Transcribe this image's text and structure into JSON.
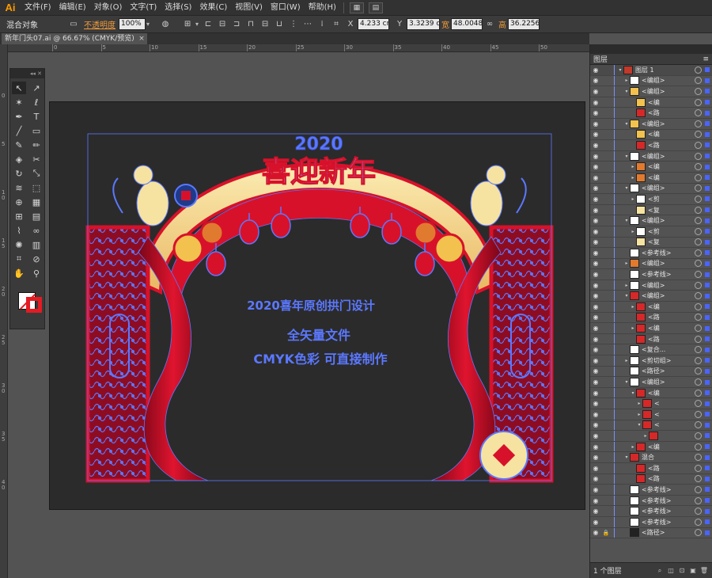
{
  "app": {
    "logo": "Ai"
  },
  "menu": {
    "items": [
      "文件(F)",
      "编辑(E)",
      "对象(O)",
      "文字(T)",
      "选择(S)",
      "效果(C)",
      "视图(V)",
      "窗口(W)",
      "帮助(H)"
    ]
  },
  "control": {
    "selection_type": "混合对象",
    "opacity_label": "不透明度",
    "opacity_value": "100%",
    "x_value": "4.233 cm",
    "y_value": "3.3239 cm",
    "w_label": "宽",
    "w_value": "48.0048",
    "h_label": "高",
    "h_value": "36.2256"
  },
  "document": {
    "tab_title": "新年门头07.ai @ 66.67% (CMYK/预览)",
    "close": "×"
  },
  "rulers": {
    "top": [
      "0",
      "5",
      "10",
      "15",
      "20",
      "25",
      "30",
      "35",
      "40",
      "45",
      "50"
    ],
    "left": [
      "0",
      "5",
      "1 0",
      "1 5",
      "2 0",
      "2 5",
      "3 0",
      "3 5",
      "4 0"
    ]
  },
  "tools": {
    "collapse": "◂◂ ✕",
    "items": [
      {
        "name": "selection-tool",
        "glyph": "↖"
      },
      {
        "name": "direct-selection-tool",
        "glyph": "↗"
      },
      {
        "name": "magic-wand-tool",
        "glyph": "✶"
      },
      {
        "name": "lasso-tool",
        "glyph": "ℓ"
      },
      {
        "name": "pen-tool",
        "glyph": "✒"
      },
      {
        "name": "type-tool",
        "glyph": "T"
      },
      {
        "name": "line-tool",
        "glyph": "╱"
      },
      {
        "name": "rectangle-tool",
        "glyph": "▭"
      },
      {
        "name": "paintbrush-tool",
        "glyph": "✎"
      },
      {
        "name": "pencil-tool",
        "glyph": "✏"
      },
      {
        "name": "blob-brush-tool",
        "glyph": "◈"
      },
      {
        "name": "eraser-tool",
        "glyph": "✂"
      },
      {
        "name": "rotate-tool",
        "glyph": "↻"
      },
      {
        "name": "scale-tool",
        "glyph": "⤡"
      },
      {
        "name": "warp-tool",
        "glyph": "≋"
      },
      {
        "name": "free-transform-tool",
        "glyph": "⬚"
      },
      {
        "name": "shape-builder-tool",
        "glyph": "⊕"
      },
      {
        "name": "perspective-grid-tool",
        "glyph": "▦"
      },
      {
        "name": "mesh-tool",
        "glyph": "⊞"
      },
      {
        "name": "gradient-tool",
        "glyph": "▤"
      },
      {
        "name": "eyedropper-tool",
        "glyph": "⌇"
      },
      {
        "name": "blend-tool",
        "glyph": "∞"
      },
      {
        "name": "symbol-sprayer-tool",
        "glyph": "✺"
      },
      {
        "name": "column-graph-tool",
        "glyph": "▥"
      },
      {
        "name": "artboard-tool",
        "glyph": "⌗"
      },
      {
        "name": "slice-tool",
        "glyph": "⊘"
      },
      {
        "name": "hand-tool",
        "glyph": "✋"
      },
      {
        "name": "zoom-tool",
        "glyph": "⚲"
      }
    ]
  },
  "artwork": {
    "title_text": "喜迎新年",
    "year_text": "2020",
    "line1": "2020喜年原创拱门设计",
    "line2": "全矢量文件",
    "line3": "CMYK色彩 可直接制作"
  },
  "layers": {
    "panel_title": "图层",
    "panel_menu": "≡",
    "rows": [
      {
        "indent": 0,
        "twisty": "▾",
        "name": "图层 1",
        "thumb": "#c0392b",
        "top": true
      },
      {
        "indent": 1,
        "twisty": "▸",
        "name": "<编组>",
        "thumb": "#ffffff"
      },
      {
        "indent": 1,
        "twisty": "▾",
        "name": "<编组>",
        "thumb": "#f2c14e"
      },
      {
        "indent": 2,
        "twisty": "",
        "name": "<编",
        "thumb": "#f2c14e"
      },
      {
        "indent": 2,
        "twisty": "",
        "name": "<路",
        "thumb": "#d62828"
      },
      {
        "indent": 1,
        "twisty": "▾",
        "name": "<编组>",
        "thumb": "#f2c14e"
      },
      {
        "indent": 2,
        "twisty": "",
        "name": "<编",
        "thumb": "#f2c14e"
      },
      {
        "indent": 2,
        "twisty": "",
        "name": "<路",
        "thumb": "#d62828"
      },
      {
        "indent": 1,
        "twisty": "▾",
        "name": "<编组>",
        "thumb": "#ffffff"
      },
      {
        "indent": 2,
        "twisty": "▸",
        "name": "<编",
        "thumb": "#e07a2f"
      },
      {
        "indent": 2,
        "twisty": "▸",
        "name": "<编",
        "thumb": "#e07a2f"
      },
      {
        "indent": 1,
        "twisty": "▾",
        "name": "<编组>",
        "thumb": "#ffffff"
      },
      {
        "indent": 2,
        "twisty": "▸",
        "name": "<剪",
        "thumb": "#ffffff"
      },
      {
        "indent": 2,
        "twisty": "",
        "name": "<复",
        "thumb": "#f6e3a1"
      },
      {
        "indent": 1,
        "twisty": "▾",
        "name": "<编组>",
        "thumb": "#ffffff"
      },
      {
        "indent": 2,
        "twisty": "▸",
        "name": "<剪",
        "thumb": "#ffffff"
      },
      {
        "indent": 2,
        "twisty": "",
        "name": "<复",
        "thumb": "#f6e3a1"
      },
      {
        "indent": 1,
        "twisty": "",
        "name": "<参考线>",
        "thumb": "#ffffff"
      },
      {
        "indent": 1,
        "twisty": "▸",
        "name": "<编组>",
        "thumb": "#e07a2f"
      },
      {
        "indent": 1,
        "twisty": "",
        "name": "<参考线>",
        "thumb": "#ffffff"
      },
      {
        "indent": 1,
        "twisty": "▸",
        "name": "<编组>",
        "thumb": "#ffffff"
      },
      {
        "indent": 1,
        "twisty": "▾",
        "name": "<编组>",
        "thumb": "#d62828"
      },
      {
        "indent": 2,
        "twisty": "▸",
        "name": "<编",
        "thumb": "#d62828"
      },
      {
        "indent": 2,
        "twisty": "",
        "name": "<路",
        "thumb": "#d62828"
      },
      {
        "indent": 2,
        "twisty": "▸",
        "name": "<编",
        "thumb": "#d62828"
      },
      {
        "indent": 2,
        "twisty": "",
        "name": "<路",
        "thumb": "#d62828"
      },
      {
        "indent": 1,
        "twisty": "",
        "name": "<复合...",
        "thumb": "#ffffff"
      },
      {
        "indent": 1,
        "twisty": "▸",
        "name": "<剪切组>",
        "thumb": "#ffffff"
      },
      {
        "indent": 1,
        "twisty": "",
        "name": "<路径>",
        "thumb": "#ffffff"
      },
      {
        "indent": 1,
        "twisty": "▾",
        "name": "<编组>",
        "thumb": "#ffffff"
      },
      {
        "indent": 2,
        "twisty": "▾",
        "name": "<编",
        "thumb": "#d62828"
      },
      {
        "indent": 3,
        "twisty": "▸",
        "name": "<",
        "thumb": "#d62828"
      },
      {
        "indent": 3,
        "twisty": "▸",
        "name": "<",
        "thumb": "#d62828"
      },
      {
        "indent": 3,
        "twisty": "▾",
        "name": "<",
        "thumb": "#d62828"
      },
      {
        "indent": 4,
        "twisty": "▸",
        "name": "",
        "thumb": "#d62828"
      },
      {
        "indent": 2,
        "twisty": "▸",
        "name": "<编",
        "thumb": "#d62828"
      },
      {
        "indent": 1,
        "twisty": "▾",
        "name": "混合",
        "thumb": "#d62828"
      },
      {
        "indent": 2,
        "twisty": "",
        "name": "<路",
        "thumb": "#d62828"
      },
      {
        "indent": 2,
        "twisty": "",
        "name": "<路",
        "thumb": "#d62828"
      },
      {
        "indent": 1,
        "twisty": "",
        "name": "<参考线>",
        "thumb": "#ffffff"
      },
      {
        "indent": 1,
        "twisty": "",
        "name": "<参考线>",
        "thumb": "#ffffff"
      },
      {
        "indent": 1,
        "twisty": "",
        "name": "<参考线>",
        "thumb": "#ffffff"
      },
      {
        "indent": 1,
        "twisty": "",
        "name": "<参考线>",
        "thumb": "#ffffff"
      },
      {
        "indent": 1,
        "twisty": "",
        "name": "<路径>",
        "thumb": "#222222",
        "locked": true
      }
    ],
    "count_label": "1 个图层"
  },
  "colors": {
    "accent_orange": "#f29b3a",
    "selection_blue": "#4a64ff",
    "arch_red": "#d8112a",
    "arch_gold": "#f6d98a"
  }
}
